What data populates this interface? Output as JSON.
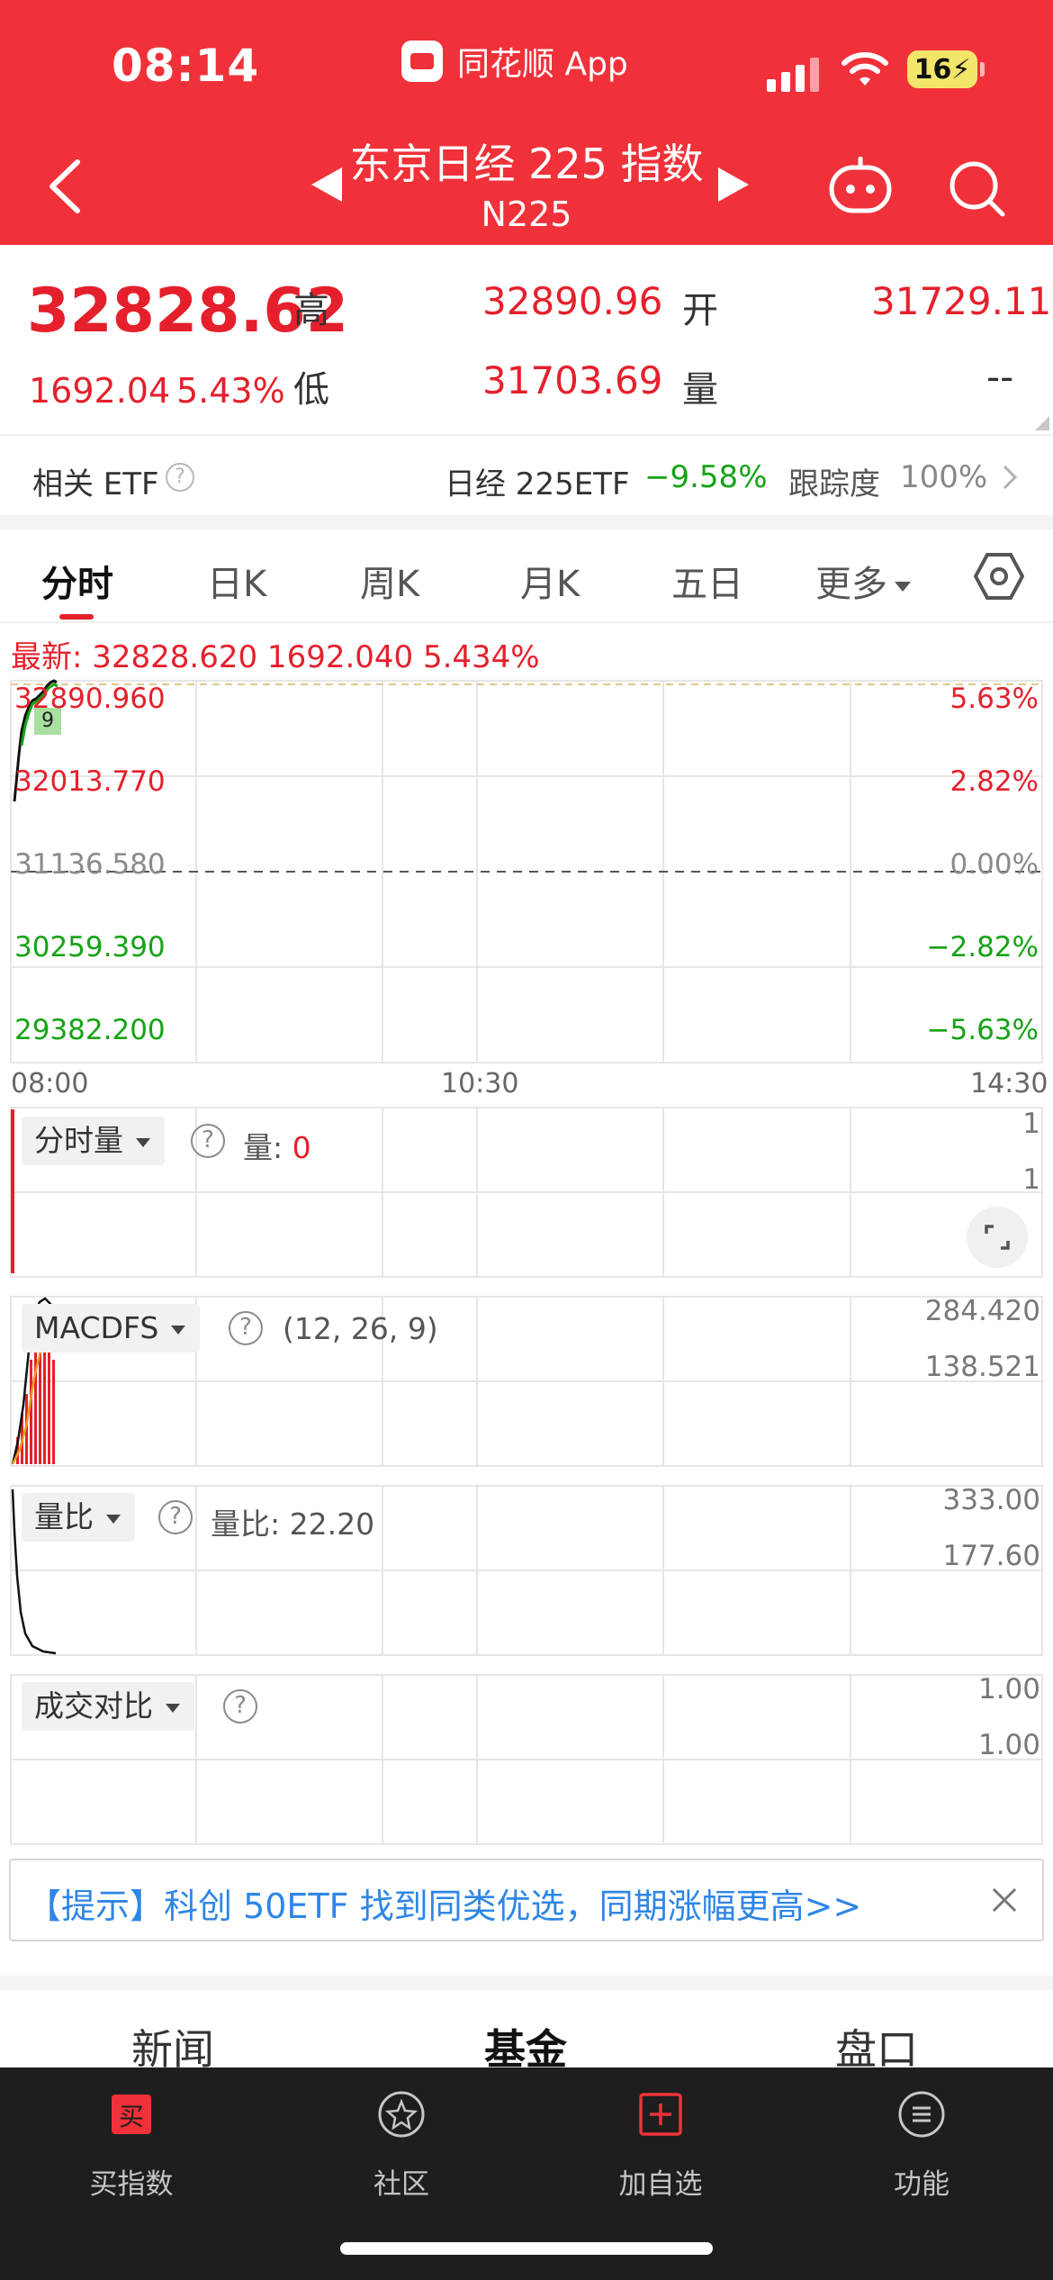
{
  "status": {
    "time": "08:14",
    "app_name": "同花顺 App",
    "battery": "16"
  },
  "header": {
    "title": "东京日经 225 指数",
    "code": "N225"
  },
  "quote": {
    "price": "32828.62",
    "change": "1692.04",
    "change_pct": "5.43%",
    "high_label": "高",
    "high": "32890.96",
    "low_label": "低",
    "low": "31703.69",
    "open_label": "开",
    "open": "31729.11",
    "volume_label": "量",
    "volume": "--"
  },
  "etf": {
    "label": "相关 ETF",
    "name": "日经 225ETF",
    "pct": "−9.58%",
    "track_label": "跟踪度",
    "track_value": "100%"
  },
  "tabs": [
    {
      "label": "分时"
    },
    {
      "label": "日K"
    },
    {
      "label": "周K"
    },
    {
      "label": "月K"
    },
    {
      "label": "五日"
    },
    {
      "label": "更多"
    }
  ],
  "chart": {
    "latest": "最新: 32828.620  1692.040  5.434%",
    "y_left": [
      "32890.960",
      "32013.770",
      "31136.580",
      "30259.390",
      "29382.200"
    ],
    "y_right": [
      "5.63%",
      "2.82%",
      "0.00%",
      "−2.82%",
      "−5.63%"
    ],
    "time_labels": [
      "08:00",
      "10:30",
      "14:30"
    ],
    "badge": "9"
  },
  "volume_panel": {
    "name": "分时量",
    "label": "量: ",
    "value": "0",
    "v1": "1",
    "v2": "1"
  },
  "macd_panel": {
    "name": "MACDFS",
    "params": "(12, 26, 9)",
    "v1": "284.420",
    "v2": "138.521"
  },
  "ratio_panel": {
    "name": "量比",
    "label": "量比: 22.20",
    "v1": "333.00",
    "v2": "177.60"
  },
  "deal_panel": {
    "name": "成交对比",
    "v1": "1.00",
    "v2": "1.00"
  },
  "tip": {
    "text": "【提示】科创 50ETF 找到同类优选，同期涨幅更高>>"
  },
  "bottom_tabs": [
    {
      "label": "新闻"
    },
    {
      "label": "基金"
    },
    {
      "label": "盘口"
    }
  ],
  "nav": [
    {
      "label": "买指数",
      "icon": "buy-icon"
    },
    {
      "label": "社区",
      "icon": "community-icon"
    },
    {
      "label": "加自选",
      "icon": "add-watchlist-icon"
    },
    {
      "label": "功能",
      "icon": "menu-icon"
    }
  ],
  "colors": {
    "header_red": "#f0313a",
    "up_red": "#e5202c",
    "down_green": "#16a316",
    "tip_blue": "#2e86e6",
    "nav_bg": "#1e1e1e"
  }
}
